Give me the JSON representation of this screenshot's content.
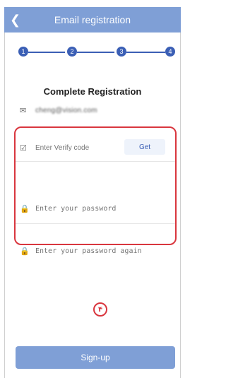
{
  "header": {
    "title": "Email registration",
    "back_icon": "chevron-left-icon"
  },
  "steps": [
    "1",
    "2",
    "3",
    "4"
  ],
  "colors": {
    "header_bg": "#7f9fd6",
    "accent": "#3b5fb5",
    "highlight": "#d9363e"
  },
  "main": {
    "title": "Complete Registration",
    "email": {
      "icon": "mail-icon",
      "value": "cheng@vision.com"
    },
    "verify": {
      "icon": "shield-check-icon",
      "placeholder": "Enter Verify code",
      "get_label": "Get"
    },
    "password": {
      "icon": "lock-icon",
      "placeholder": "Enter your password"
    },
    "password_again": {
      "icon": "lock-icon",
      "placeholder": "Enter your password again"
    }
  },
  "annotation": {
    "label": "۴"
  },
  "footer": {
    "signup_label": "Sign-up"
  }
}
